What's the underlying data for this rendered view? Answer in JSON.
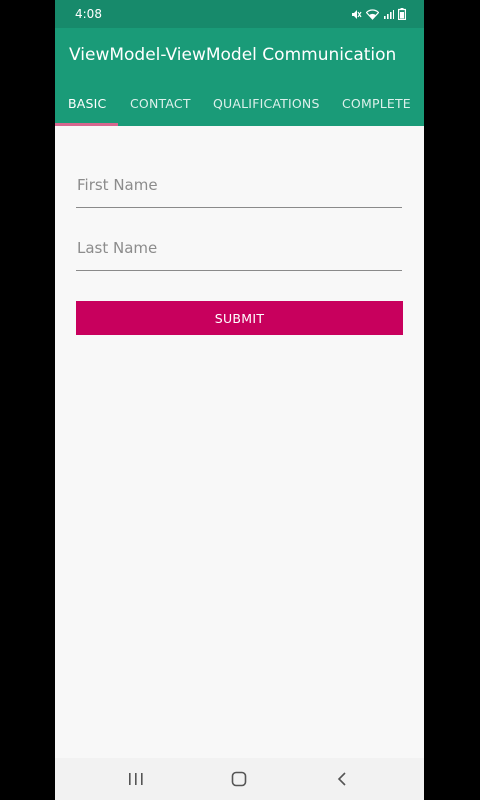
{
  "status_bar": {
    "time": "4:08",
    "icons": [
      "mute-icon",
      "wifi-icon",
      "signal-icon",
      "battery-icon"
    ]
  },
  "app_bar": {
    "title": "ViewModel-ViewModel Communication",
    "color": "#1a9b78",
    "status_color": "#178a6b"
  },
  "tabs": [
    {
      "label": "BASIC",
      "active": true
    },
    {
      "label": "CONTACT",
      "active": false
    },
    {
      "label": "QUALIFICATIONS",
      "active": false
    },
    {
      "label": "COMPLETE",
      "active": false
    }
  ],
  "tab_indicator_color": "#d7678f",
  "form": {
    "first_name": {
      "placeholder": "First Name",
      "value": ""
    },
    "last_name": {
      "placeholder": "Last Name",
      "value": ""
    },
    "submit_label": "SUBMIT",
    "submit_color": "#c8005d"
  },
  "nav_bar": {
    "buttons": [
      "recents-icon",
      "home-icon",
      "back-icon"
    ]
  }
}
